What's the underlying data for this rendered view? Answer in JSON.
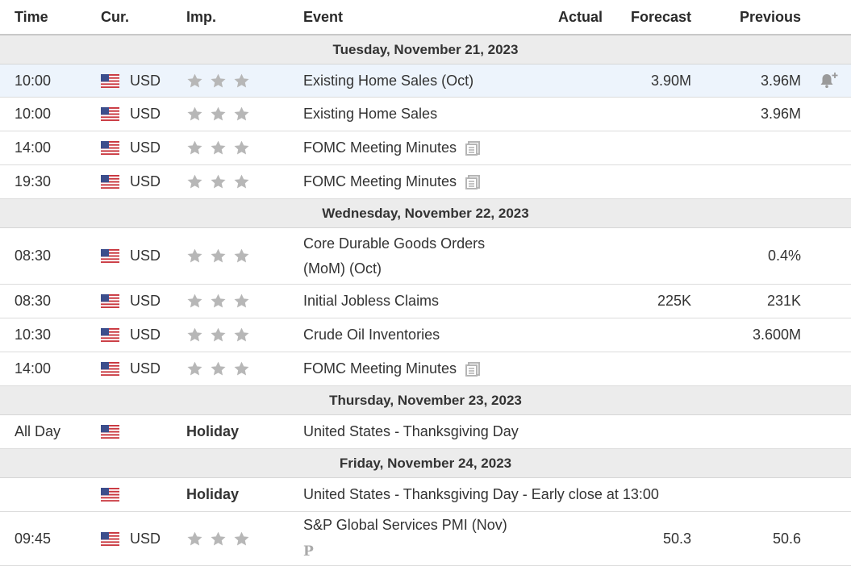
{
  "header": {
    "time": "Time",
    "cur": "Cur.",
    "imp": "Imp.",
    "event": "Event",
    "actual": "Actual",
    "forecast": "Forecast",
    "previous": "Previous"
  },
  "days": [
    {
      "label": "Tuesday, November 21, 2023",
      "events": [
        {
          "time": "10:00",
          "cur": "USD",
          "imp": "",
          "event": "Existing Home Sales (Oct)",
          "actual": "",
          "forecast": "3.90M",
          "previous": "3.96M"
        },
        {
          "time": "10:00",
          "cur": "USD",
          "imp": "",
          "event": "Existing Home Sales",
          "actual": "",
          "forecast": "",
          "previous": "3.96M"
        },
        {
          "time": "14:00",
          "cur": "USD",
          "imp": "",
          "event": "FOMC Meeting Minutes",
          "actual": "",
          "forecast": "",
          "previous": ""
        },
        {
          "time": "19:30",
          "cur": "USD",
          "imp": "",
          "event": "FOMC Meeting Minutes",
          "actual": "",
          "forecast": "",
          "previous": ""
        }
      ]
    },
    {
      "label": "Wednesday, November 22, 2023",
      "events": [
        {
          "time": "08:30",
          "cur": "USD",
          "imp": "",
          "event_line1": "Core Durable Goods Orders",
          "event_line2": "(MoM) (Oct)",
          "actual": "",
          "forecast": "",
          "previous": "0.4%"
        },
        {
          "time": "08:30",
          "cur": "USD",
          "imp": "",
          "event": "Initial Jobless Claims",
          "actual": "",
          "forecast": "225K",
          "previous": "231K"
        },
        {
          "time": "10:30",
          "cur": "USD",
          "imp": "",
          "event": "Crude Oil Inventories",
          "actual": "",
          "forecast": "",
          "previous": "3.600M"
        },
        {
          "time": "14:00",
          "cur": "USD",
          "imp": "",
          "event": "FOMC Meeting Minutes",
          "actual": "",
          "forecast": "",
          "previous": ""
        }
      ]
    },
    {
      "label": "Thursday, November 23, 2023",
      "events": [
        {
          "time": "All Day",
          "cur": "",
          "imp": "Holiday",
          "event": "United States - Thanksgiving Day",
          "actual": "",
          "forecast": "",
          "previous": ""
        }
      ]
    },
    {
      "label": "Friday, November 24, 2023",
      "events": [
        {
          "time": "",
          "cur": "",
          "imp": "Holiday",
          "event": "United States - Thanksgiving Day - Early close at 13:00",
          "actual": "",
          "forecast": "",
          "previous": ""
        },
        {
          "time": "09:45",
          "cur": "USD",
          "imp": "",
          "event": "S&P Global Services PMI (Nov)",
          "actual": "",
          "forecast": "50.3",
          "previous": "50.6",
          "badge": "P"
        }
      ]
    }
  ],
  "importance_stars": 3,
  "icons": {
    "flag": "us-flag-icon",
    "star": "star-icon",
    "minutes": "document-icon",
    "alert": "bell-plus-icon"
  },
  "colors": {
    "highlight_row": "#edf4fc",
    "day_header_bg": "#ececec",
    "star": "#b7b7b7"
  }
}
